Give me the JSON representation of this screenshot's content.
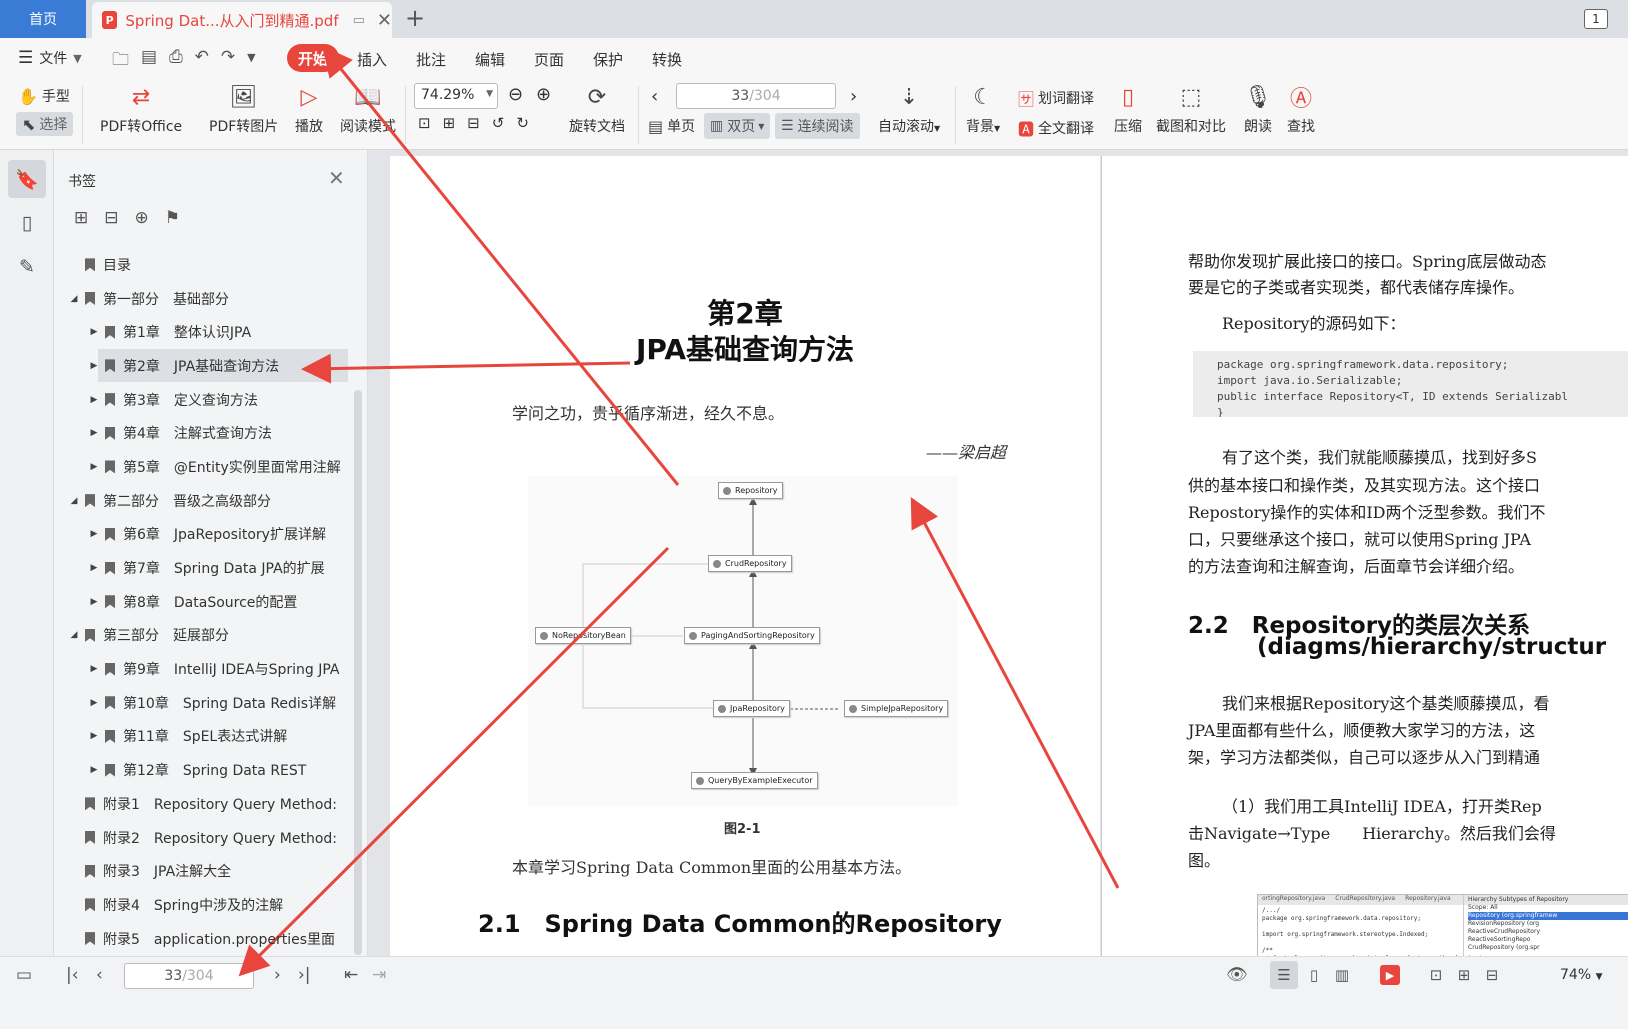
{
  "tabs": {
    "home": "首页",
    "doc_icon": "P",
    "doc_title": "Spring Dat...从入门到精通.pdf",
    "window_count": "1"
  },
  "menu": {
    "file": "文件",
    "start": "开始",
    "items": [
      "插入",
      "批注",
      "编辑",
      "页面",
      "保护",
      "转换"
    ]
  },
  "ribbon": {
    "hand": "手型",
    "select": "选择",
    "pdf_to_office": "PDF转Office",
    "pdf_to_image": "PDF转图片",
    "play": "播放",
    "read_mode": "阅读模式",
    "zoom": "74.29%",
    "rotate_doc": "旋转文档",
    "page_current": "33",
    "page_total": "/304",
    "single_page": "单页",
    "double_page": "双页",
    "continuous": "连续阅读",
    "auto_scroll": "自动滚动",
    "background": "背景",
    "word_translate": "划词翻译",
    "full_translate": "全文翻译",
    "compress": "压缩",
    "screenshot_compare": "截图和对比",
    "read_aloud": "朗读",
    "find": "查找"
  },
  "bookmarks": {
    "title": "书签",
    "items": [
      {
        "level": 0,
        "text": "目录",
        "expand": ""
      },
      {
        "level": 0,
        "text": "第一部分　基础部分",
        "expand": "◢"
      },
      {
        "level": 1,
        "text": "第1章　整体认识JPA",
        "expand": "▶"
      },
      {
        "level": 1,
        "text": "第2章　JPA基础查询方法",
        "expand": "▶",
        "selected": true
      },
      {
        "level": 1,
        "text": "第3章　定义查询方法",
        "expand": "▶"
      },
      {
        "level": 1,
        "text": "第4章　注解式查询方法",
        "expand": "▶"
      },
      {
        "level": 1,
        "text": "第5章　@Entity实例里面常用注解",
        "expand": "▶"
      },
      {
        "level": 0,
        "text": "第二部分　晋级之高级部分",
        "expand": "◢"
      },
      {
        "level": 1,
        "text": "第6章　JpaRepository扩展详解",
        "expand": "▶"
      },
      {
        "level": 1,
        "text": "第7章　Spring Data JPA的扩展",
        "expand": "▶"
      },
      {
        "level": 1,
        "text": "第8章　DataSource的配置",
        "expand": "▶"
      },
      {
        "level": 0,
        "text": "第三部分　延展部分",
        "expand": "◢"
      },
      {
        "level": 1,
        "text": "第9章　IntelliJ IDEA与Spring JPA",
        "expand": "▶"
      },
      {
        "level": 1,
        "text": "第10章　Spring Data Redis详解",
        "expand": "▶"
      },
      {
        "level": 1,
        "text": "第11章　SpEL表达式讲解",
        "expand": "▶"
      },
      {
        "level": 1,
        "text": "第12章　Spring Data REST",
        "expand": "▶"
      },
      {
        "level": 0,
        "text": "附录1　Repository Query Method:",
        "expand": ""
      },
      {
        "level": 0,
        "text": "附录2　Repository Query Method:",
        "expand": ""
      },
      {
        "level": 0,
        "text": "附录3　JPA注解大全",
        "expand": ""
      },
      {
        "level": 0,
        "text": "附录4　Spring中涉及的注解",
        "expand": ""
      },
      {
        "level": 0,
        "text": "附录5　application.properties里面",
        "expand": ""
      }
    ]
  },
  "page_left": {
    "chapter": "第2章",
    "chapter_title": "JPA基础查询方法",
    "quote": "学问之功，贵乎循序渐进，经久不息。",
    "quote_author": "——梁启超",
    "diagram_nodes": {
      "repository": "Repository",
      "crud": "CrudRepository",
      "no_repo_bean": "NoRepositoryBean",
      "paging": "PagingAndSortingRepository",
      "jpa": "JpaRepository",
      "simple_jpa": "SimpleJpaRepository",
      "qbe": "QueryByExampleExecutor"
    },
    "figure_caption": "图2-1",
    "summary": "本章学习Spring Data Common里面的公用基本方法。",
    "section": "2.1　Spring Data Common的Repository"
  },
  "page_right": {
    "p1_l1": "帮助你发现扩展此接口的接口。Spring底层做动态",
    "p1_l2": "要是它的子类或者实现类，都代表储存库操作。",
    "p2": "Repository的源码如下：",
    "code": "package org.springframework.data.repository;\nimport java.io.Serializable;\npublic interface Repository<T, ID extends Serializabl\n}",
    "p3_l1": "有了这个类，我们就能顺藤摸瓜，找到好多S",
    "p3_l2": "供的基本接口和操作类，及其实现方法。这个接口",
    "p3_l3": "Repostory操作的实体和ID两个泛型参数。我们不",
    "p3_l4": "口，只要继承这个接口，就可以使用Spring JPA",
    "p3_l5": "的方法查询和注解查询，后面章节会详细介绍。",
    "section_l1": "2.2　Repository的类层次关系",
    "section_l2": "(diagms/hierarchy/structur",
    "p4_l1": "我们来根据Repository这个基类顺藤摸瓜，看",
    "p4_l2": "JPA里面都有些什么，顺便教大家学习的方法，这",
    "p4_l3": "架，学习方法都类似，自己可以逐步从入门到精通",
    "p5_l1": "（1）我们用工具IntelliJ IDEA，打开类Rep",
    "p5_l2": "击Navigate→Type　　Hierarchy。然后我们会得",
    "p5_l3": "图。",
    "shot_tabs": [
      "ortingRepository.java",
      "CrudRepository.java",
      "Repository.java",
      "Hierarchy Subtypes of Repository"
    ],
    "shot_code": "/.../\npackage org.springframework.data.repository;\n\nimport org.springframework.stereotype.Indexed;\n\n/**\n * Central repository marker interface. Captures the domain typ\n * purpose is to hold type information as well as being able to",
    "shot_hier_title": "Scope: All",
    "shot_hier_items": [
      "Repository (org.springframew",
      "RevisionRepository (org",
      "ReactiveCrudRepository",
      "ReactiveSortingRepo",
      "CrudRepository (org.spr"
    ]
  },
  "status": {
    "page_current": "33",
    "page_total": "/304",
    "zoom": "74%"
  },
  "colors": {
    "accent_red": "#e8453c",
    "home_blue": "#3a7bd5"
  }
}
